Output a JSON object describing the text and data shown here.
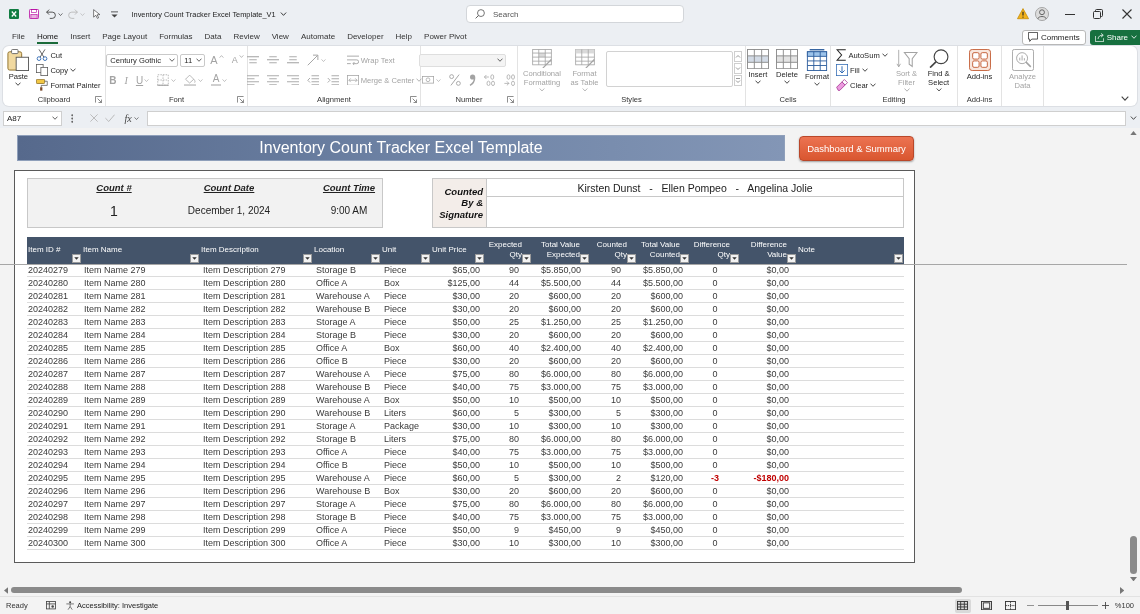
{
  "title_bar": {
    "title": "Inventory Count Tracker Excel Template_V1",
    "undo": {
      "disabled": false
    },
    "redo": {
      "disabled": true
    },
    "search": {
      "placeholder": "Search"
    }
  },
  "menu_tabs": [
    {
      "label": "File",
      "selected": false
    },
    {
      "label": "Home",
      "selected": true
    },
    {
      "label": "Insert",
      "selected": false
    },
    {
      "label": "Page Layout",
      "selected": false
    },
    {
      "label": "Formulas",
      "selected": false
    },
    {
      "label": "Data",
      "selected": false
    },
    {
      "label": "Review",
      "selected": false
    },
    {
      "label": "View",
      "selected": false
    },
    {
      "label": "Automate",
      "selected": false
    },
    {
      "label": "Developer",
      "selected": false
    },
    {
      "label": "Help",
      "selected": false
    },
    {
      "label": "Power Pivot",
      "selected": false
    }
  ],
  "header_buttons": {
    "comments": "Comments",
    "share": "Share"
  },
  "ribbon": {
    "groups": [
      {
        "name": "Clipboard",
        "launcher": true,
        "columns": [
          [
            [
              {
                "kind": "large",
                "label": "Paste",
                "menu": true,
                "disabled": false
              }
            ]
          ],
          [
            [
              {
                "kind": "small",
                "label": "Cut",
                "menu": false,
                "disabled": false
              }
            ],
            [
              {
                "kind": "small",
                "label": "Copy",
                "menu": true,
                "disabled": false
              }
            ],
            [
              {
                "kind": "small",
                "label": "Format Painter",
                "menu": false,
                "disabled": false
              }
            ]
          ]
        ]
      },
      {
        "name": "Font",
        "launcher": true,
        "columns": [
          [
            [
              {
                "kind": "combo",
                "value": "Century Gothic",
                "menu": true,
                "disabled": false
              },
              {
                "kind": "combo",
                "value": "11",
                "menu": true,
                "disabled": false
              },
              {
                "kind": "grow",
                "label": "A",
                "menu": false,
                "disabled": true
              },
              {
                "kind": "shrink",
                "label": "A",
                "menu": false,
                "disabled": true
              }
            ],
            [
              {
                "kind": "bold",
                "label": "B",
                "menu": false,
                "disabled": true
              },
              {
                "kind": "italic",
                "label": "I",
                "menu": false,
                "disabled": true
              },
              {
                "kind": "underline",
                "label": "U",
                "menu": true,
                "disabled": true
              },
              {
                "kind": "icon",
                "menu": true,
                "disabled": true
              },
              {
                "kind": "icon",
                "menu": true,
                "disabled": true
              },
              {
                "kind": "fontcolor",
                "label": "A",
                "menu": true,
                "disabled": true
              }
            ]
          ]
        ]
      },
      {
        "name": "Alignment",
        "launcher": true,
        "columns": [
          [
            [
              {
                "kind": "icon",
                "menu": false,
                "disabled": true
              },
              {
                "kind": "icon",
                "menu": false,
                "disabled": true
              },
              {
                "kind": "icon",
                "menu": false,
                "disabled": true
              },
              {
                "kind": "icon",
                "menu": true,
                "disabled": true
              }
            ],
            [
              {
                "kind": "icon",
                "menu": false,
                "disabled": true
              },
              {
                "kind": "icon",
                "menu": false,
                "disabled": true
              },
              {
                "kind": "icon",
                "menu": false,
                "disabled": true
              },
              {
                "kind": "icon",
                "menu": false,
                "disabled": true
              },
              {
                "kind": "icon",
                "menu": false,
                "disabled": true
              }
            ]
          ],
          [
            [
              {
                "kind": "small",
                "label": "Wrap Text",
                "menu": false,
                "disabled": true
              }
            ],
            [
              {
                "kind": "small",
                "label": "Merge & Center",
                "menu": true,
                "disabled": true
              }
            ]
          ]
        ]
      },
      {
        "name": "Number",
        "launcher": true,
        "columns": [
          [
            [
              {
                "kind": "combo",
                "menu": true,
                "disabled": true
              }
            ],
            [
              {
                "kind": "icon",
                "menu": true,
                "disabled": true
              },
              {
                "kind": "icon",
                "menu": false,
                "disabled": true
              },
              {
                "kind": "icon",
                "menu": false,
                "disabled": true
              },
              {
                "kind": "icon",
                "menu": false,
                "disabled": true
              },
              {
                "kind": "icon",
                "menu": false,
                "disabled": true
              }
            ]
          ]
        ]
      },
      {
        "name": "Styles",
        "launcher": false,
        "columns": [
          [
            [
              {
                "kind": "large",
                "label": "Conditional Formatting",
                "menu": true,
                "disabled": true
              }
            ]
          ],
          [
            [
              {
                "kind": "large",
                "label": "Format as Table",
                "menu": true,
                "disabled": true
              }
            ]
          ],
          [
            [
              {
                "kind": "gallery"
              }
            ]
          ]
        ]
      },
      {
        "name": "Cells",
        "launcher": false,
        "columns": [
          [
            [
              {
                "kind": "large",
                "label": "Insert",
                "menu": true,
                "disabled": false
              }
            ]
          ],
          [
            [
              {
                "kind": "large",
                "label": "Delete",
                "menu": true,
                "disabled": false
              }
            ]
          ],
          [
            [
              {
                "kind": "large",
                "label": "Format",
                "menu": true,
                "disabled": false
              }
            ]
          ]
        ]
      },
      {
        "name": "Editing",
        "launcher": false,
        "columns": [
          [
            [
              {
                "kind": "small",
                "label": "AutoSum",
                "menu": true,
                "disabled": false
              }
            ],
            [
              {
                "kind": "small",
                "label": "Fill",
                "menu": true,
                "disabled": false
              }
            ],
            [
              {
                "kind": "small",
                "label": "Clear",
                "menu": true,
                "disabled": false
              }
            ]
          ],
          [
            [
              {
                "kind": "large",
                "label": "Sort & Filter",
                "menu": true,
                "disabled": true
              }
            ]
          ],
          [
            [
              {
                "kind": "large",
                "label": "Find & Select",
                "menu": true,
                "disabled": false
              }
            ]
          ]
        ]
      },
      {
        "name": "Add-ins",
        "launcher": false,
        "columns": [
          [
            [
              {
                "kind": "large",
                "label": "Add-ins",
                "menu": false,
                "disabled": false
              }
            ]
          ]
        ]
      },
      {
        "columns": [
          [
            [
              {
                "kind": "large",
                "label": "Analyze Data",
                "menu": false,
                "disabled": true
              }
            ]
          ]
        ]
      }
    ]
  },
  "formula_bar": {
    "name_box": "A87",
    "function_label": "fx",
    "cancel": {
      "disabled": true
    },
    "enter": {
      "disabled": true
    }
  },
  "sheet": {
    "banner": "Inventory Count Tracker Excel Template",
    "dashboard_button": "Dashboard & Summary",
    "count_info": [
      {
        "heading": "Count #",
        "value": "1"
      },
      {
        "heading": "Count Date",
        "value": "December 1, 2024"
      },
      {
        "heading": "Count Time",
        "value": "9:00 AM"
      }
    ],
    "signature": {
      "label": "Counted By & Signature",
      "counters": "Kirsten Dunst   -   Ellen Pompeo   -   Angelina Jolie"
    },
    "table": {
      "columns": [
        {
          "label": "Item ID #",
          "filter": true
        },
        {
          "label": "Item Name",
          "filter": true
        },
        {
          "label": "Item Description",
          "filter": true
        },
        {
          "label": "Location",
          "filter": true
        },
        {
          "label": "Unit",
          "filter": true
        },
        {
          "label": "Unit Price",
          "filter": true
        },
        {
          "label": "Expected Qty",
          "filter": true
        },
        {
          "label": "Total Value Expected",
          "filter": true
        },
        {
          "label": "Counted Qty",
          "filter": true
        },
        {
          "label": "Total Value Counted",
          "filter": true
        },
        {
          "label": "Difference Qty",
          "filter": true
        },
        {
          "label": "Difference Value",
          "filter": true
        },
        {
          "label": "Note",
          "filter": true
        }
      ],
      "rows": [
        {
          "cells": [
            "20240279",
            "Item Name 279",
            "Item Description 279",
            "Storage B",
            "Piece",
            "$65,00",
            "90",
            "$5.850,00",
            "90",
            "$5.850,00",
            "0",
            "$0,00"
          ],
          "discrepancy": false
        },
        {
          "cells": [
            "20240280",
            "Item Name 280",
            "Item Description 280",
            "Office A",
            "Box",
            "$125,00",
            "44",
            "$5.500,00",
            "44",
            "$5.500,00",
            "0",
            "$0,00"
          ],
          "discrepancy": false
        },
        {
          "cells": [
            "20240281",
            "Item Name 281",
            "Item Description 281",
            "Warehouse A",
            "Piece",
            "$30,00",
            "20",
            "$600,00",
            "20",
            "$600,00",
            "0",
            "$0,00"
          ],
          "discrepancy": false
        },
        {
          "cells": [
            "20240282",
            "Item Name 282",
            "Item Description 282",
            "Warehouse B",
            "Piece",
            "$30,00",
            "20",
            "$600,00",
            "20",
            "$600,00",
            "0",
            "$0,00"
          ],
          "discrepancy": false
        },
        {
          "cells": [
            "20240283",
            "Item Name 283",
            "Item Description 283",
            "Storage A",
            "Piece",
            "$50,00",
            "25",
            "$1.250,00",
            "25",
            "$1.250,00",
            "0",
            "$0,00"
          ],
          "discrepancy": false
        },
        {
          "cells": [
            "20240284",
            "Item Name 284",
            "Item Description 284",
            "Storage B",
            "Piece",
            "$30,00",
            "20",
            "$600,00",
            "20",
            "$600,00",
            "0",
            "$0,00"
          ],
          "discrepancy": false
        },
        {
          "cells": [
            "20240285",
            "Item Name 285",
            "Item Description 285",
            "Office A",
            "Box",
            "$60,00",
            "40",
            "$2.400,00",
            "40",
            "$2.400,00",
            "0",
            "$0,00"
          ],
          "discrepancy": false
        },
        {
          "cells": [
            "20240286",
            "Item Name 286",
            "Item Description 286",
            "Office B",
            "Piece",
            "$30,00",
            "20",
            "$600,00",
            "20",
            "$600,00",
            "0",
            "$0,00"
          ],
          "discrepancy": false
        },
        {
          "cells": [
            "20240287",
            "Item Name 287",
            "Item Description 287",
            "Warehouse A",
            "Piece",
            "$75,00",
            "80",
            "$6.000,00",
            "80",
            "$6.000,00",
            "0",
            "$0,00"
          ],
          "discrepancy": false
        },
        {
          "cells": [
            "20240288",
            "Item Name 288",
            "Item Description 288",
            "Warehouse B",
            "Piece",
            "$40,00",
            "75",
            "$3.000,00",
            "75",
            "$3.000,00",
            "0",
            "$0,00"
          ],
          "discrepancy": false
        },
        {
          "cells": [
            "20240289",
            "Item Name 289",
            "Item Description 289",
            "Warehouse A",
            "Box",
            "$50,00",
            "10",
            "$500,00",
            "10",
            "$500,00",
            "0",
            "$0,00"
          ],
          "discrepancy": false
        },
        {
          "cells": [
            "20240290",
            "Item Name 290",
            "Item Description 290",
            "Warehouse B",
            "Liters",
            "$60,00",
            "5",
            "$300,00",
            "5",
            "$300,00",
            "0",
            "$0,00"
          ],
          "discrepancy": false
        },
        {
          "cells": [
            "20240291",
            "Item Name 291",
            "Item Description 291",
            "Storage A",
            "Package",
            "$30,00",
            "10",
            "$300,00",
            "10",
            "$300,00",
            "0",
            "$0,00"
          ],
          "discrepancy": false
        },
        {
          "cells": [
            "20240292",
            "Item Name 292",
            "Item Description 292",
            "Storage B",
            "Liters",
            "$75,00",
            "80",
            "$6.000,00",
            "80",
            "$6.000,00",
            "0",
            "$0,00"
          ],
          "discrepancy": false
        },
        {
          "cells": [
            "20240293",
            "Item Name 293",
            "Item Description 293",
            "Office A",
            "Piece",
            "$40,00",
            "75",
            "$3.000,00",
            "75",
            "$3.000,00",
            "0",
            "$0,00"
          ],
          "discrepancy": false
        },
        {
          "cells": [
            "20240294",
            "Item Name 294",
            "Item Description 294",
            "Office B",
            "Piece",
            "$50,00",
            "10",
            "$500,00",
            "10",
            "$500,00",
            "0",
            "$0,00"
          ],
          "discrepancy": false
        },
        {
          "cells": [
            "20240295",
            "Item Name 295",
            "Item Description 295",
            "Warehouse A",
            "Piece",
            "$60,00",
            "5",
            "$300,00",
            "2",
            "$120,00",
            "-3",
            "-$180,00"
          ],
          "discrepancy": true
        },
        {
          "cells": [
            "20240296",
            "Item Name 296",
            "Item Description 296",
            "Warehouse B",
            "Box",
            "$30,00",
            "20",
            "$600,00",
            "20",
            "$600,00",
            "0",
            "$0,00"
          ],
          "discrepancy": false
        },
        {
          "cells": [
            "20240297",
            "Item Name 297",
            "Item Description 297",
            "Storage A",
            "Piece",
            "$75,00",
            "80",
            "$6.000,00",
            "80",
            "$6.000,00",
            "0",
            "$0,00"
          ],
          "discrepancy": false
        },
        {
          "cells": [
            "20240298",
            "Item Name 298",
            "Item Description 298",
            "Storage B",
            "Piece",
            "$40,00",
            "75",
            "$3.000,00",
            "75",
            "$3.000,00",
            "0",
            "$0,00"
          ],
          "discrepancy": false
        },
        {
          "cells": [
            "20240299",
            "Item Name 299",
            "Item Description 299",
            "Office A",
            "Piece",
            "$50,00",
            "9",
            "$450,00",
            "9",
            "$450,00",
            "0",
            "$0,00"
          ],
          "discrepancy": false
        },
        {
          "cells": [
            "20240300",
            "Item Name 300",
            "Item Description 300",
            "Office A",
            "Piece",
            "$30,00",
            "10",
            "$300,00",
            "10",
            "$300,00",
            "0",
            "$0,00"
          ],
          "discrepancy": false
        }
      ]
    }
  },
  "status_bar": {
    "status": "Ready",
    "accessibility": "Accessibility: Investigate",
    "views": [
      {
        "selected": true
      },
      {
        "selected": false
      },
      {
        "selected": false
      }
    ],
    "zoom": {
      "level": 0.5,
      "reading": "%100"
    }
  }
}
